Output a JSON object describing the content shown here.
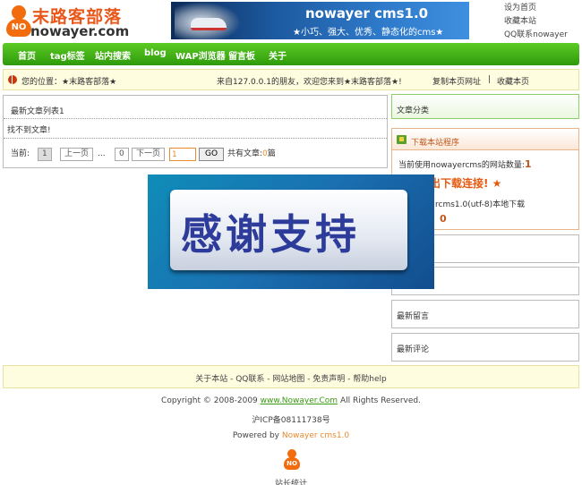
{
  "logo": {
    "cn": "末路客部落",
    "en": "nowayer.com",
    "mascot_text": "NO"
  },
  "banner": {
    "title": "nowayer cms1.0",
    "subtitle": "★小巧、强大、优秀、静态化的cms★"
  },
  "toplinks": [
    "设为首页",
    "收藏本站",
    "QQ联系nowayer"
  ],
  "nav": [
    "首页",
    "tag标签",
    "站内搜索",
    "blog",
    "WAP浏览器",
    "留言板",
    "关于"
  ],
  "position": {
    "label": "您的位置：★末路客部落★",
    "welcome": "来自127.0.0.1的朋友，欢迎您来到★末路客部落★!",
    "copy_link": "复制本页网址",
    "divider": "|",
    "bookmark": "收藏本页"
  },
  "main": {
    "list_title": "最新文章列表1",
    "empty": "找不到文章!",
    "pager": {
      "current_label": "当前:",
      "current": "1",
      "prev": "上一页",
      "ellipsis": "...",
      "last": "0",
      "next": "下一页",
      "page_input": "1",
      "go": "GO",
      "total_label": "共有文章:",
      "total": "0",
      "unit": "篇"
    }
  },
  "sidebar": {
    "categories_title": "文章分类",
    "download_title": "下载本站程序",
    "usage_text": "当前使用nowayercms的网站数量:",
    "usage_count": "1",
    "download_link": "进出下载连接! ★",
    "version_text": "rcms1.0(utf-8)本地下载",
    "version_count": "0",
    "latest_comments_label": "最新留言",
    "latest_reviews_label": "最新评论"
  },
  "overlay": {
    "text": "感谢支持"
  },
  "footer": {
    "links": "关于本站 - QQ联系 - 网站地图 - 免责声明 - 帮助help",
    "copyright_pre": "Copyright © 2008-2009",
    "copyright_link": "www.Nowayer.Com",
    "copyright_post": "All Rights Reserved.",
    "icp": "沪ICP备08111738号",
    "powered_pre": "Powered by",
    "powered_link": "Nowayer cms1.0",
    "stats": "站长统计"
  },
  "colors": {
    "nav_green": "#2e9a0c",
    "accent_orange": "#e88a2e",
    "logo_orange": "#f26b0c"
  }
}
